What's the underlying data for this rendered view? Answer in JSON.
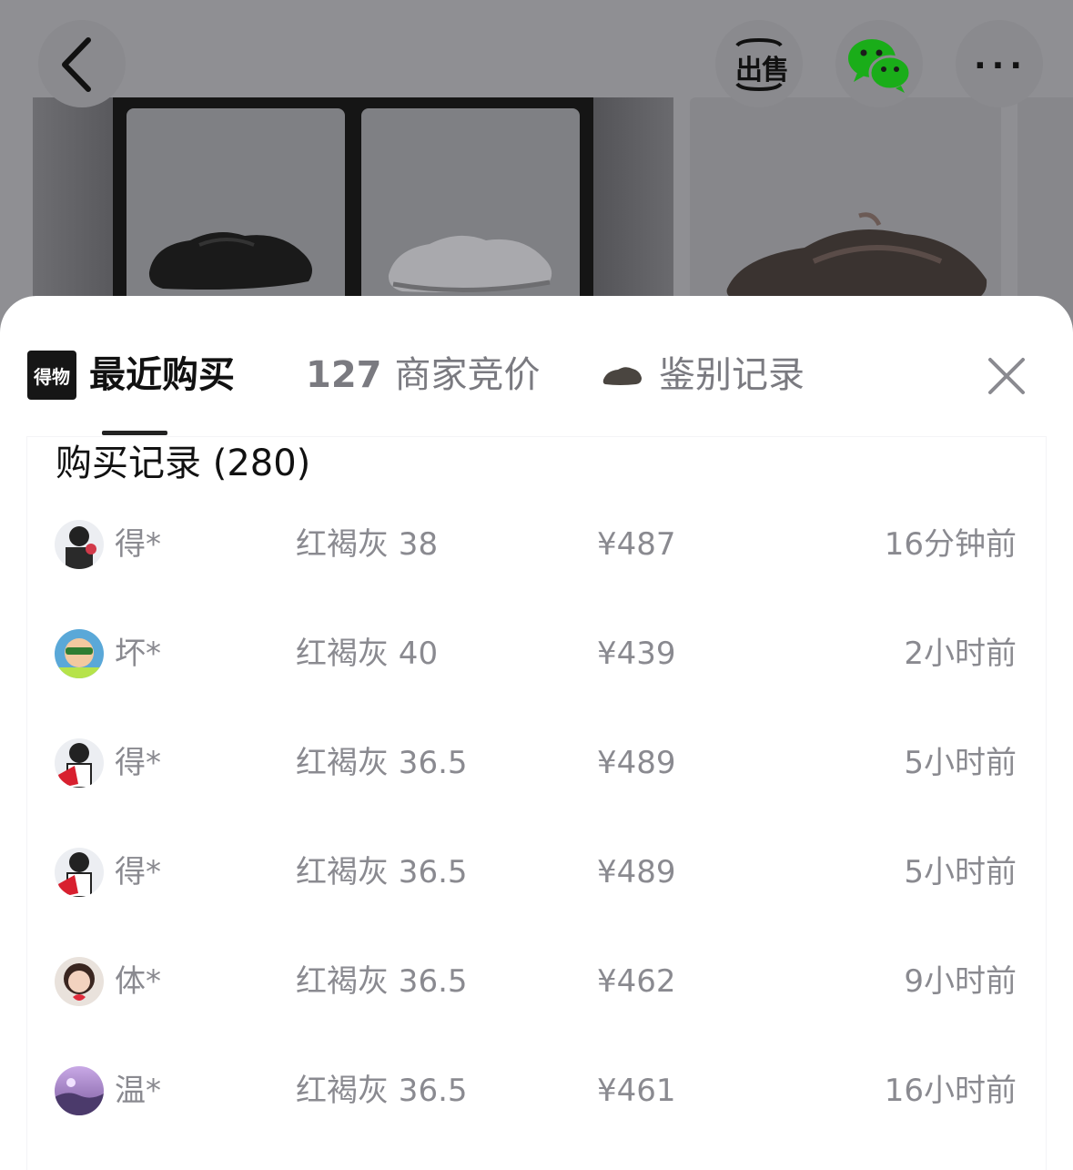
{
  "header": {
    "sell_label": "出售",
    "more_label": "···"
  },
  "sheet": {
    "logo_text": "得物",
    "tabs": [
      {
        "label": "最近购买"
      },
      {
        "count": "127",
        "label": "商家竞价"
      },
      {
        "label": "鉴别记录"
      }
    ]
  },
  "records": {
    "title": "购买记录 (280)",
    "rows": [
      {
        "name": "得*",
        "spec": "红褐灰 38",
        "price": "¥487",
        "time": "16分钟前"
      },
      {
        "name": "坏*",
        "spec": "红褐灰 40",
        "price": "¥439",
        "time": "2小时前"
      },
      {
        "name": "得*",
        "spec": "红褐灰 36.5",
        "price": "¥489",
        "time": "5小时前"
      },
      {
        "name": "得*",
        "spec": "红褐灰 36.5",
        "price": "¥489",
        "time": "5小时前"
      },
      {
        "name": "体*",
        "spec": "红褐灰 36.5",
        "price": "¥462",
        "time": "9小时前"
      },
      {
        "name": "温*",
        "spec": "红褐灰 36.5",
        "price": "¥461",
        "time": "16小时前"
      }
    ]
  },
  "colors": {
    "overlay": "#8e8e92",
    "text_primary": "#111111",
    "text_secondary": "#8a8a90",
    "wechat_green": "#1aad19"
  }
}
